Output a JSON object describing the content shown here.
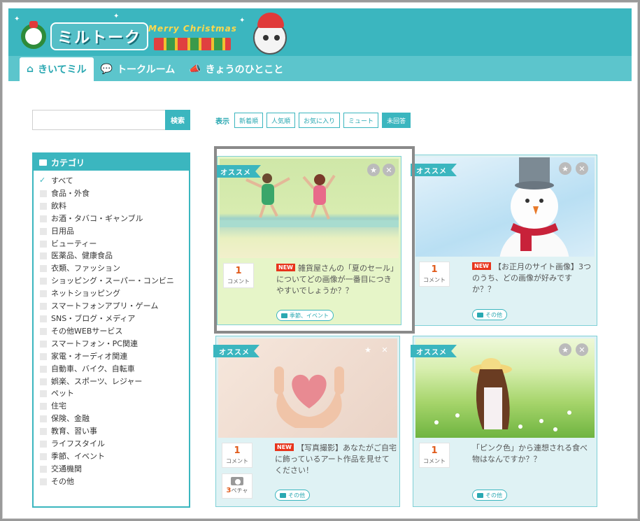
{
  "header": {
    "logo_text": "ミルトーク",
    "banner_text": "Merry Christmas"
  },
  "nav": {
    "tabs": [
      {
        "label": "きいてミル",
        "icon": "question-board-icon",
        "active": true
      },
      {
        "label": "トークルーム",
        "icon": "speech-bubbles-icon",
        "active": false
      },
      {
        "label": "きょうのひとこと",
        "icon": "megaphone-icon",
        "active": false
      }
    ]
  },
  "search": {
    "value": "",
    "placeholder": "",
    "button_label": "検索"
  },
  "filters": {
    "label": "表示",
    "options": [
      {
        "label": "新着順",
        "selected": false
      },
      {
        "label": "人気順",
        "selected": false
      },
      {
        "label": "お気に入り",
        "selected": false
      },
      {
        "label": "ミュート",
        "selected": false
      },
      {
        "label": "未回答",
        "selected": true
      }
    ]
  },
  "categories": {
    "title": "カテゴリ",
    "items": [
      {
        "label": "すべて",
        "checked": true
      },
      {
        "label": "食品・外食",
        "checked": false
      },
      {
        "label": "飲料",
        "checked": false
      },
      {
        "label": "お酒・タバコ・ギャンブル",
        "checked": false
      },
      {
        "label": "日用品",
        "checked": false
      },
      {
        "label": "ビューティー",
        "checked": false
      },
      {
        "label": "医薬品、健康食品",
        "checked": false
      },
      {
        "label": "衣類、ファッション",
        "checked": false
      },
      {
        "label": "ショッピング・スーパー・コンビニ",
        "checked": false
      },
      {
        "label": "ネットショッピング",
        "checked": false
      },
      {
        "label": "スマートフォンアプリ・ゲーム",
        "checked": false
      },
      {
        "label": "SNS・ブログ・メディア",
        "checked": false
      },
      {
        "label": "その他WEBサービス",
        "checked": false
      },
      {
        "label": "スマートフォン・PC関連",
        "checked": false
      },
      {
        "label": "家電・オーディオ関連",
        "checked": false
      },
      {
        "label": "自動車、バイク、自転車",
        "checked": false
      },
      {
        "label": "娯楽、スポーツ、レジャー",
        "checked": false
      },
      {
        "label": "ペット",
        "checked": false
      },
      {
        "label": "住宅",
        "checked": false
      },
      {
        "label": "保険、金融",
        "checked": false
      },
      {
        "label": "教育、習い事",
        "checked": false
      },
      {
        "label": "ライフスタイル",
        "checked": false
      },
      {
        "label": "季節、イベント",
        "checked": false
      },
      {
        "label": "交通機関",
        "checked": false
      },
      {
        "label": "その他",
        "checked": false
      }
    ]
  },
  "cards": [
    {
      "ribbon": "オススメ",
      "count": "1",
      "count_label": "コメント",
      "new_badge": "NEW",
      "title": "雑貨屋さんの「夏のセール」についてどの画像が一番目につきやすいでしょうか？？",
      "tag": "季節、イベント",
      "image": "beach"
    },
    {
      "ribbon": "オススメ",
      "count": "1",
      "count_label": "コメント",
      "new_badge": "NEW",
      "title": "【お正月のサイト画像】3つのうち、どの画像が好みですか？？",
      "tag": "その他",
      "image": "snowman"
    },
    {
      "ribbon": "オススメ",
      "count": "1",
      "count_label": "コメント",
      "new_badge": "NEW",
      "title": "【写真撮影】あなたがご自宅に飾っているアート作品を見せてください！",
      "tag": "その他",
      "image": "heart-hands",
      "photo_count": "3",
      "photo_label": "ペチャ"
    },
    {
      "ribbon": "オススメ",
      "count": "1",
      "count_label": "コメント",
      "new_badge": "",
      "title": "「ピンク色」から連想される食べ物はなんですか？？",
      "tag": "その他",
      "image": "flower-field"
    }
  ]
}
